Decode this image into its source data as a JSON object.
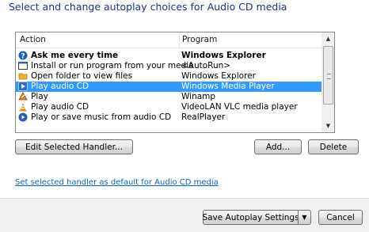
{
  "heading": "Select and change autoplay choices for Audio CD media",
  "list": {
    "columns": {
      "action": "Action",
      "program": "Program"
    },
    "rows": [
      {
        "icon": "question-icon",
        "action": "Ask me every time",
        "program": "Windows Explorer",
        "bold": true,
        "selected": false
      },
      {
        "icon": "window-icon",
        "action": "Install or run program from your media",
        "program": "<AutoRun>",
        "bold": false,
        "selected": false
      },
      {
        "icon": "folder-icon",
        "action": "Open folder to view files",
        "program": "Windows Explorer",
        "bold": false,
        "selected": false
      },
      {
        "icon": "play-icon",
        "action": "Play audio CD",
        "program": "Windows Media Player",
        "bold": false,
        "selected": true
      },
      {
        "icon": "winamp-icon",
        "action": "Play",
        "program": "Winamp",
        "bold": false,
        "selected": false
      },
      {
        "icon": "vlc-cone-icon",
        "action": "Play audio CD",
        "program": "VideoLAN VLC media player",
        "bold": false,
        "selected": false
      },
      {
        "icon": "realplayer-icon",
        "action": "Play or save music from audio CD",
        "program": "RealPlayer",
        "bold": false,
        "selected": false
      }
    ]
  },
  "buttons": {
    "edit_handler": "Edit Selected Handler...",
    "add": "Add...",
    "delete": "Delete",
    "save": "Save Autoplay Settings",
    "cancel": "Cancel"
  },
  "link": "Set selected handler as default for Audio CD media",
  "colors": {
    "selection": "#3399ff",
    "heading": "#1e3287",
    "link": "#0066cc"
  }
}
